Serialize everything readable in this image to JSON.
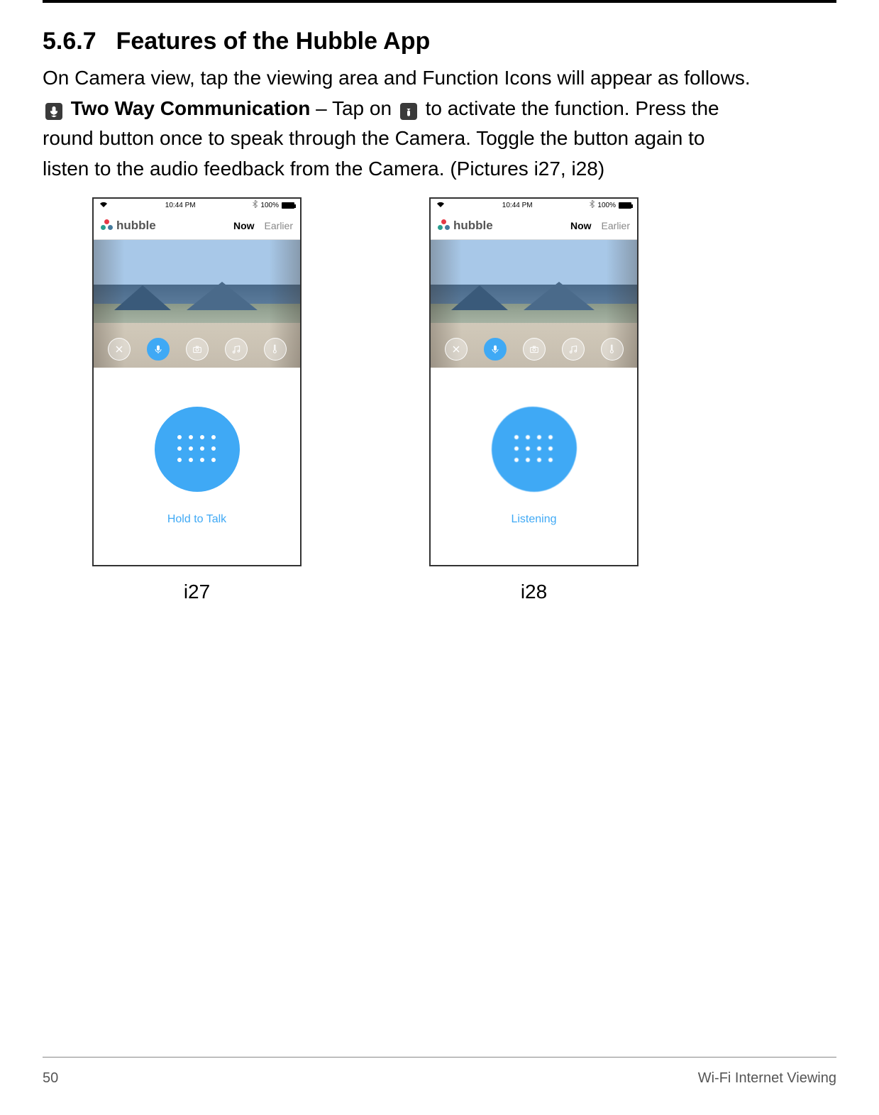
{
  "heading": {
    "number": "5.6.7",
    "title": "Features of the Hubble App"
  },
  "paragraph": {
    "line1": "On Camera view, tap the viewing area and Function Icons will appear as follows.",
    "feature_name": "Two Way Communication",
    "line2_a": " – Tap on ",
    "line2_b": " to activate the function. Press the ",
    "line3": "round button once to speak through the Camera. Toggle the button again to ",
    "line4": "listen to the audio feedback from the Camera. (Pictures i27, i28)"
  },
  "phone_common": {
    "status": {
      "time": "10:44 PM",
      "battery": "100%"
    },
    "app_name": "hubble",
    "tabs": {
      "now": "Now",
      "earlier": "Earlier"
    }
  },
  "screenshots": [
    {
      "label": "Hold to Talk",
      "caption": "i27",
      "button_state": "hold"
    },
    {
      "label": "Listening",
      "caption": "i28",
      "button_state": "listening"
    }
  ],
  "footer": {
    "page": "50",
    "section": "Wi-Fi Internet Viewing"
  }
}
